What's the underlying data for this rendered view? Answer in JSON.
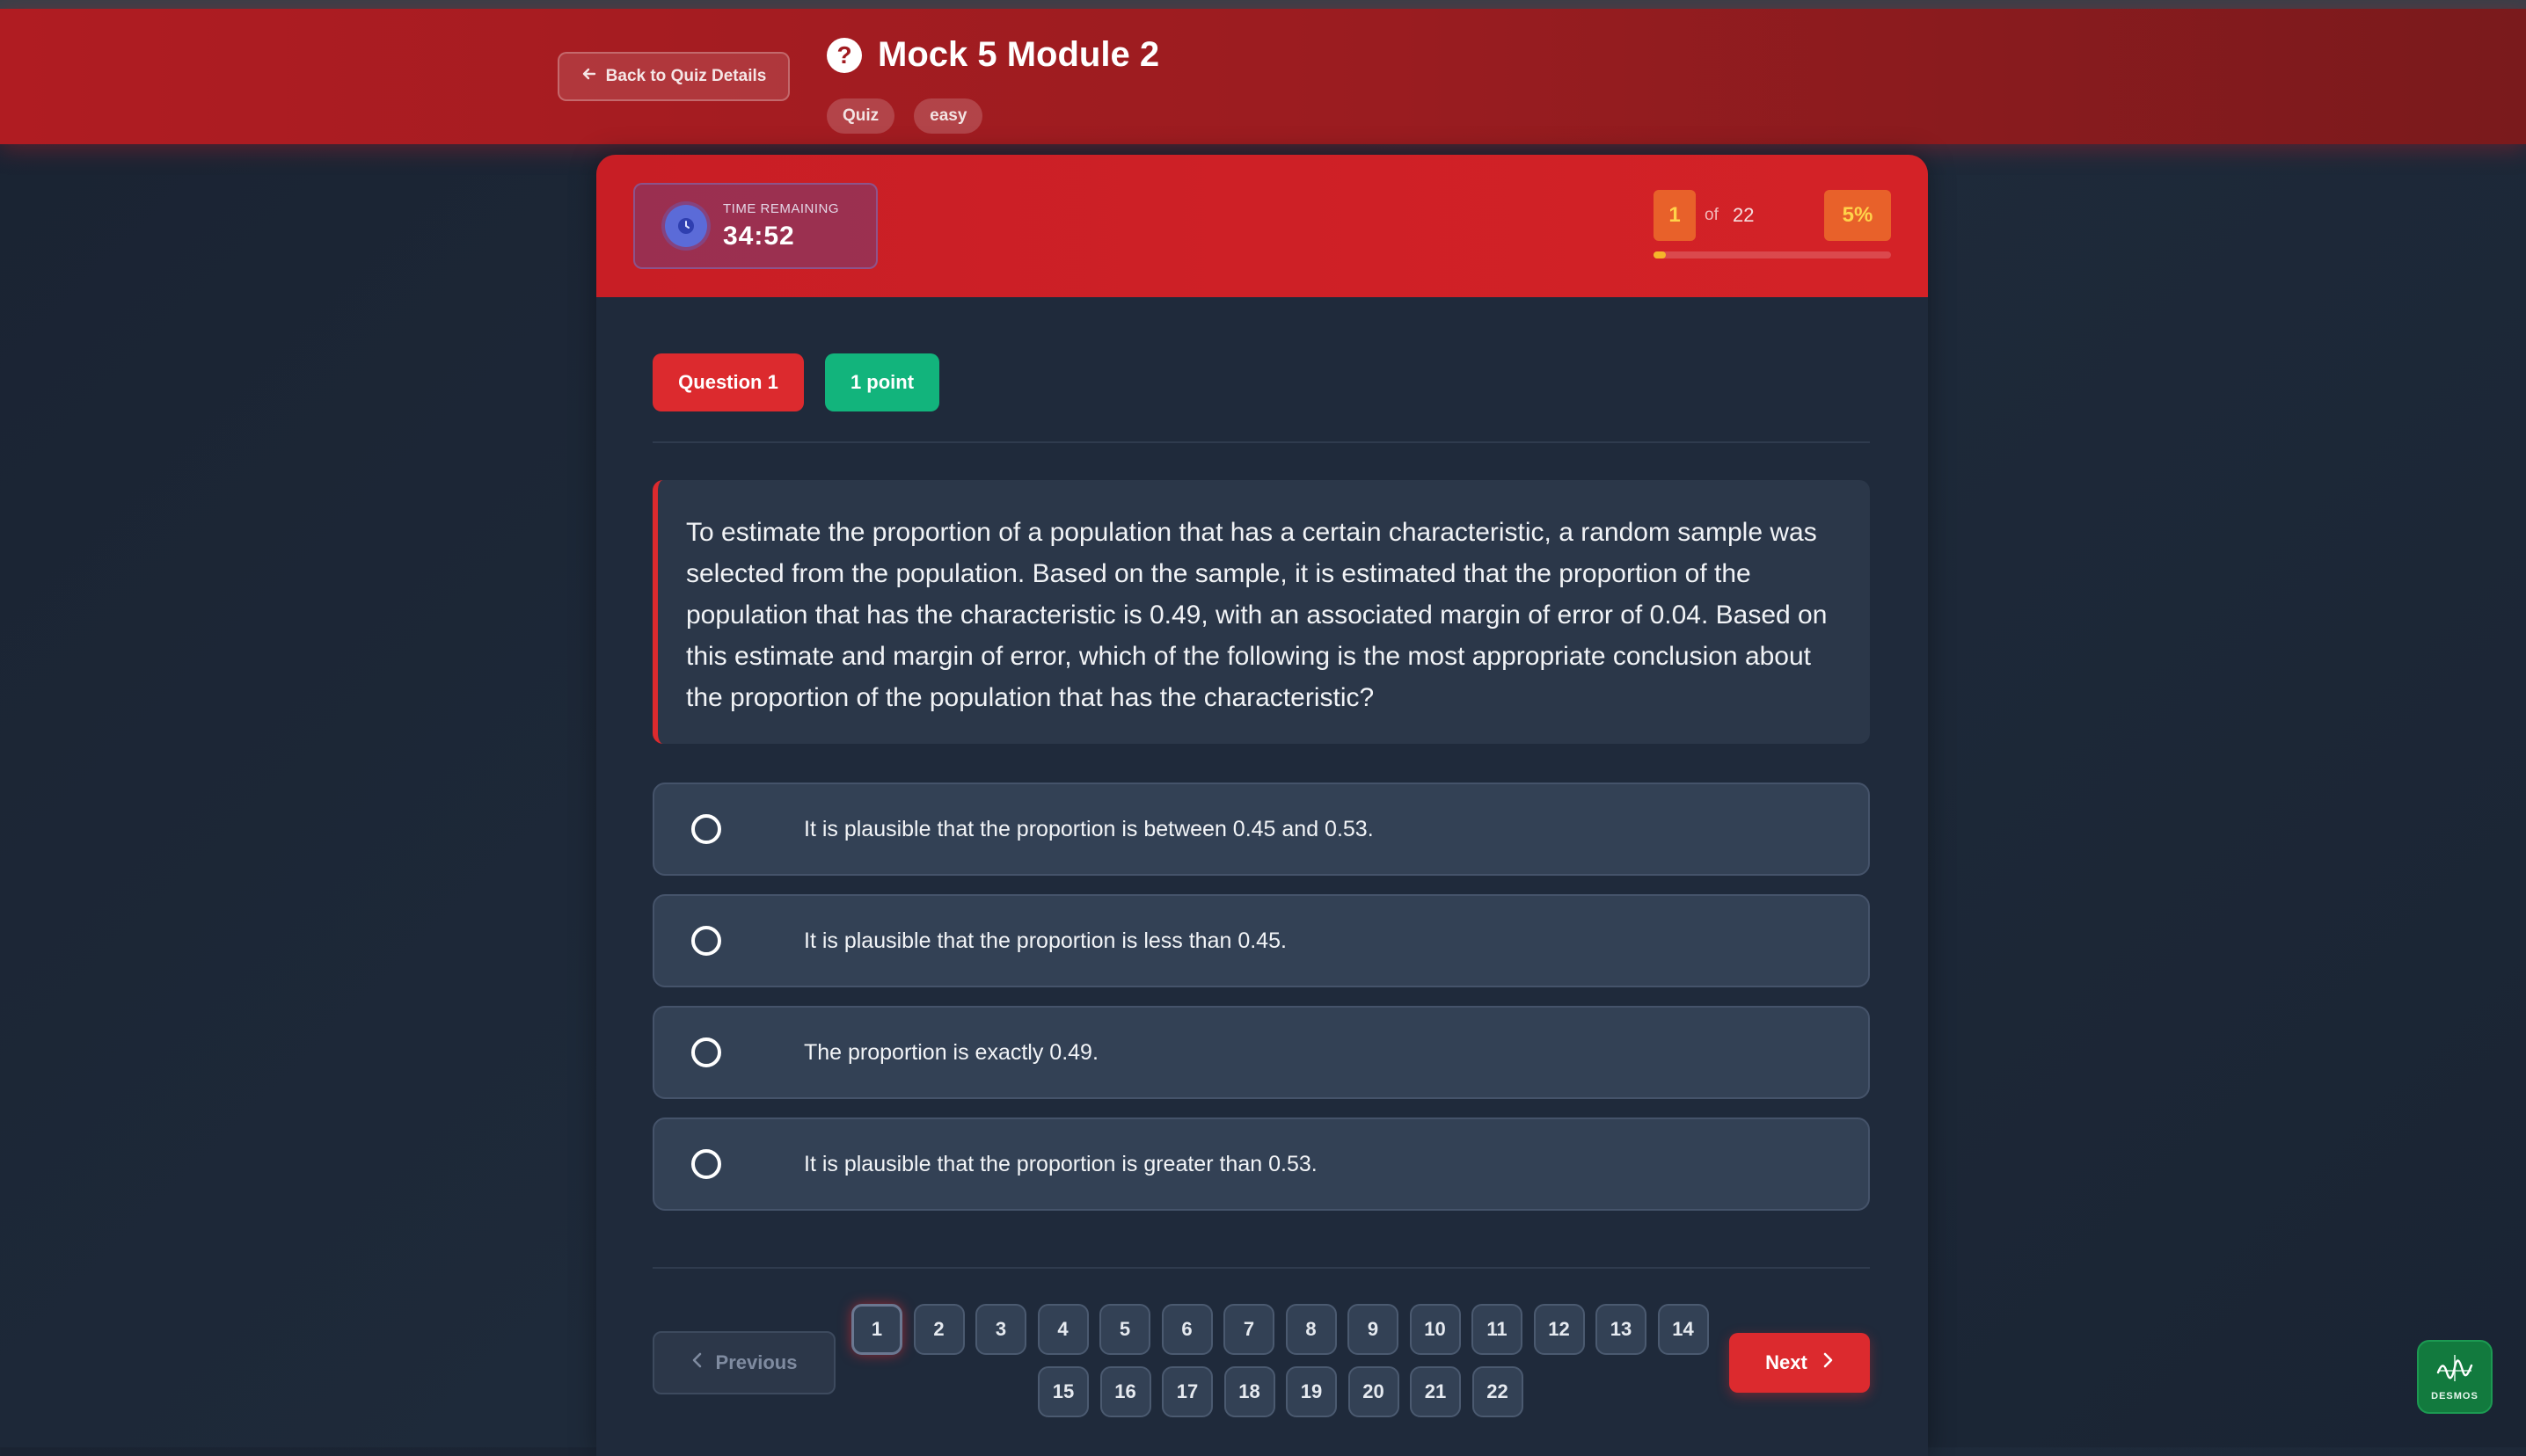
{
  "header": {
    "back_label": "Back to Quiz Details",
    "title": "Mock 5 Module 2",
    "tags": [
      "Quiz",
      "easy"
    ]
  },
  "timer": {
    "label": "TIME REMAINING",
    "value": "34:52"
  },
  "progress": {
    "current": "1",
    "of_label": "of",
    "total": "22",
    "percent_label": "5%",
    "fraction": 0.05
  },
  "question": {
    "badge": "Question 1",
    "points": "1 point",
    "text": "To estimate the proportion of a population that has a certain characteristic, a random sample was selected from the population. Based on the sample, it is estimated that the proportion of the population that has the characteristic is 0.49, with an associated margin of error of 0.04. Based on this estimate and margin of error, which of the following is the most appropriate conclusion about the proportion of the population that has the characteristic?"
  },
  "options": [
    "It is plausible that the proportion is between 0.45 and 0.53.",
    "It is plausible that the proportion is less than 0.45.",
    "The proportion is exactly 0.49.",
    "It is plausible that the proportion is greater than 0.53."
  ],
  "nav": {
    "previous_label": "Previous",
    "next_label": "Next",
    "pages": [
      "1",
      "2",
      "3",
      "4",
      "5",
      "6",
      "7",
      "8",
      "9",
      "10",
      "11",
      "12",
      "13",
      "14",
      "15",
      "16",
      "17",
      "18",
      "19",
      "20",
      "21",
      "22"
    ]
  },
  "desmos": {
    "label": "DESMOS"
  },
  "colors": {
    "accent_red": "#dc2a2e",
    "points_green": "#12b47c",
    "progress_yellow": "#f5b52a"
  }
}
